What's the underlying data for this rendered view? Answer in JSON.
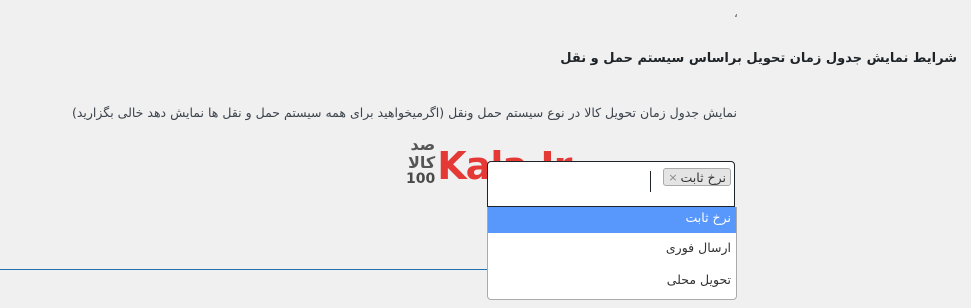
{
  "top_mark": "،",
  "section": {
    "heading": "شرایط نمایش جدول زمان تحویل براساس سیستم حمل و نقل",
    "description": "نمایش جدول زمان تحویل کالا در نوع سیستم حمل ونقل (اگرمیخواهید برای همه سیستم حمل و نقل ها نمایش دهد خالی بگزارید)"
  },
  "watermark": {
    "farsi": "صد کالا",
    "number": "100",
    "brand": "Kala.Ir"
  },
  "select": {
    "selected_tags": [
      {
        "label": "نرخ ثابت",
        "remove": "×"
      }
    ],
    "options": [
      {
        "label": "نرخ ثابت",
        "highlighted": true
      },
      {
        "label": "ارسال فوری",
        "highlighted": false
      },
      {
        "label": "تحویل محلی",
        "highlighted": false
      }
    ]
  },
  "colors": {
    "background": "#f0f0f1",
    "highlight": "#5897fb",
    "brand_red": "#e53935",
    "divider_blue": "#2271b1"
  }
}
